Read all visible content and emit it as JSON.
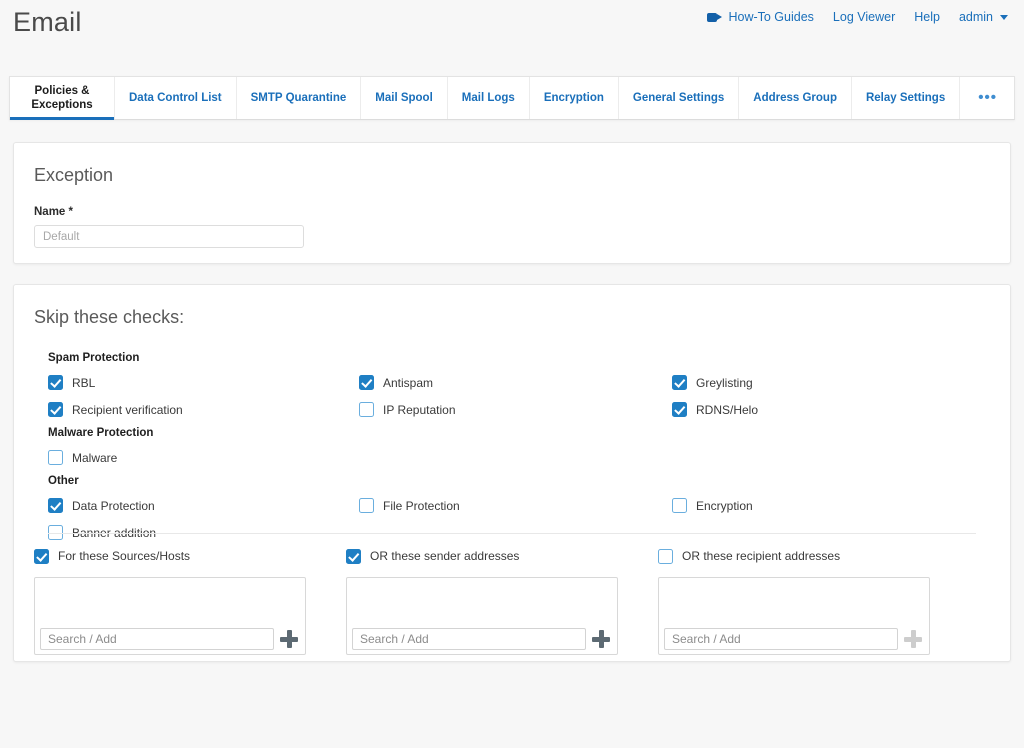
{
  "header": {
    "title": "Email",
    "links": [
      {
        "label": "How-To Guides",
        "icon": "video-camera-icon"
      },
      {
        "label": "Log Viewer",
        "icon": null
      },
      {
        "label": "Help",
        "icon": null
      },
      {
        "label": "admin",
        "icon": "chevron-down-icon"
      }
    ]
  },
  "tabs": [
    {
      "label": "Policies & Exceptions",
      "active": true
    },
    {
      "label": "Data Control List",
      "active": false
    },
    {
      "label": "SMTP Quarantine",
      "active": false
    },
    {
      "label": "Mail Spool",
      "active": false
    },
    {
      "label": "Mail Logs",
      "active": false
    },
    {
      "label": "Encryption",
      "active": false
    },
    {
      "label": "General Settings",
      "active": false
    },
    {
      "label": "Address Group",
      "active": false
    },
    {
      "label": "Relay Settings",
      "active": false
    }
  ],
  "tabs_overflow_label": "•••",
  "exception_panel": {
    "title": "Exception",
    "name_label": "Name *",
    "name_value": "",
    "name_placeholder": "Default"
  },
  "skip_checks_panel": {
    "title": "Skip these checks:",
    "groups": {
      "spam": "Spam Protection",
      "malware": "Malware Protection",
      "other": "Other"
    },
    "column1": [
      {
        "label": "RBL",
        "checked": true
      },
      {
        "label": "Recipient verification",
        "checked": true
      },
      {
        "label": "Malware",
        "checked": false
      },
      {
        "label": "Data Protection",
        "checked": true
      },
      {
        "label": "Banner addition",
        "checked": false
      }
    ],
    "column2": [
      {
        "label": "Antispam",
        "checked": true
      },
      {
        "label": "IP Reputation",
        "checked": false
      },
      {
        "label": "File Protection",
        "checked": false
      }
    ],
    "column3": [
      {
        "label": "Greylisting",
        "checked": true
      },
      {
        "label": "RDNS/Helo",
        "checked": true
      },
      {
        "label": "Encryption",
        "checked": false
      }
    ]
  },
  "sources": [
    {
      "label": "For these Sources/Hosts",
      "checked": true,
      "search_placeholder": "Search / Add",
      "search_value": "",
      "items": [],
      "add_enabled": true
    },
    {
      "label": "OR these sender addresses",
      "checked": true,
      "search_placeholder": "Search / Add",
      "search_value": "",
      "items": [],
      "add_enabled": true
    },
    {
      "label": "OR these recipient addresses",
      "checked": false,
      "search_placeholder": "Search / Add",
      "search_value": "",
      "items": [],
      "add_enabled": false
    }
  ],
  "colors": {
    "accent": "#1a6fba",
    "checkbox_on": "#1f7fc4",
    "checkbox_border": "#6aaede",
    "page_bg": "#f7f7f7"
  }
}
